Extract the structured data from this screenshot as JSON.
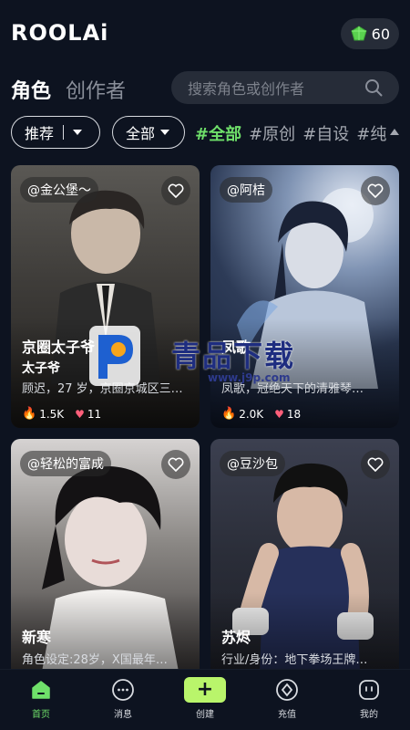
{
  "app": {
    "logo_text": "ROOLAi"
  },
  "header": {
    "coins": "60"
  },
  "tabs": [
    {
      "label": "角色",
      "active": true
    },
    {
      "label": "创作者",
      "active": false
    }
  ],
  "search": {
    "placeholder": "搜索角色或创作者"
  },
  "filters": {
    "sort_label": "推荐",
    "gender_label": "全部",
    "tags": [
      "#全部",
      "#原创",
      "#自设",
      "#纯"
    ]
  },
  "cards": [
    {
      "creator": "@金公堡～",
      "name": "京圈太子爷",
      "subtitle": "太子爷",
      "desc": "顾迟，27 岁，京圈京城区三…",
      "hot": "1.5K",
      "likes": "11"
    },
    {
      "creator": "@阿桔",
      "name": "凤歌",
      "subtitle": "",
      "desc": "凤歌，冠绝天下的清雅琴…",
      "hot": "2.0K",
      "likes": "18"
    },
    {
      "creator": "@轻松的富成",
      "name": "新寒",
      "subtitle": "",
      "desc": "角色设定:28岁，X国最年…"
    },
    {
      "creator": "@豆沙包",
      "name": "苏烬",
      "subtitle": "",
      "desc": "行业/身份：地下拳场王牌…"
    }
  ],
  "watermark": {
    "text": "青品下载",
    "url": "www.j9p.com"
  },
  "nav": [
    {
      "label": "首页",
      "icon": "home-icon",
      "active": true
    },
    {
      "label": "消息",
      "icon": "message-icon",
      "active": false
    },
    {
      "label": "创建",
      "icon": "plus-icon",
      "active": false
    },
    {
      "label": "充值",
      "icon": "diamond-icon",
      "active": false
    },
    {
      "label": "我的",
      "icon": "profile-icon",
      "active": false
    }
  ],
  "colors": {
    "accent": "#6fe06a",
    "background": "#0d1320",
    "create": "#b9f56b"
  }
}
